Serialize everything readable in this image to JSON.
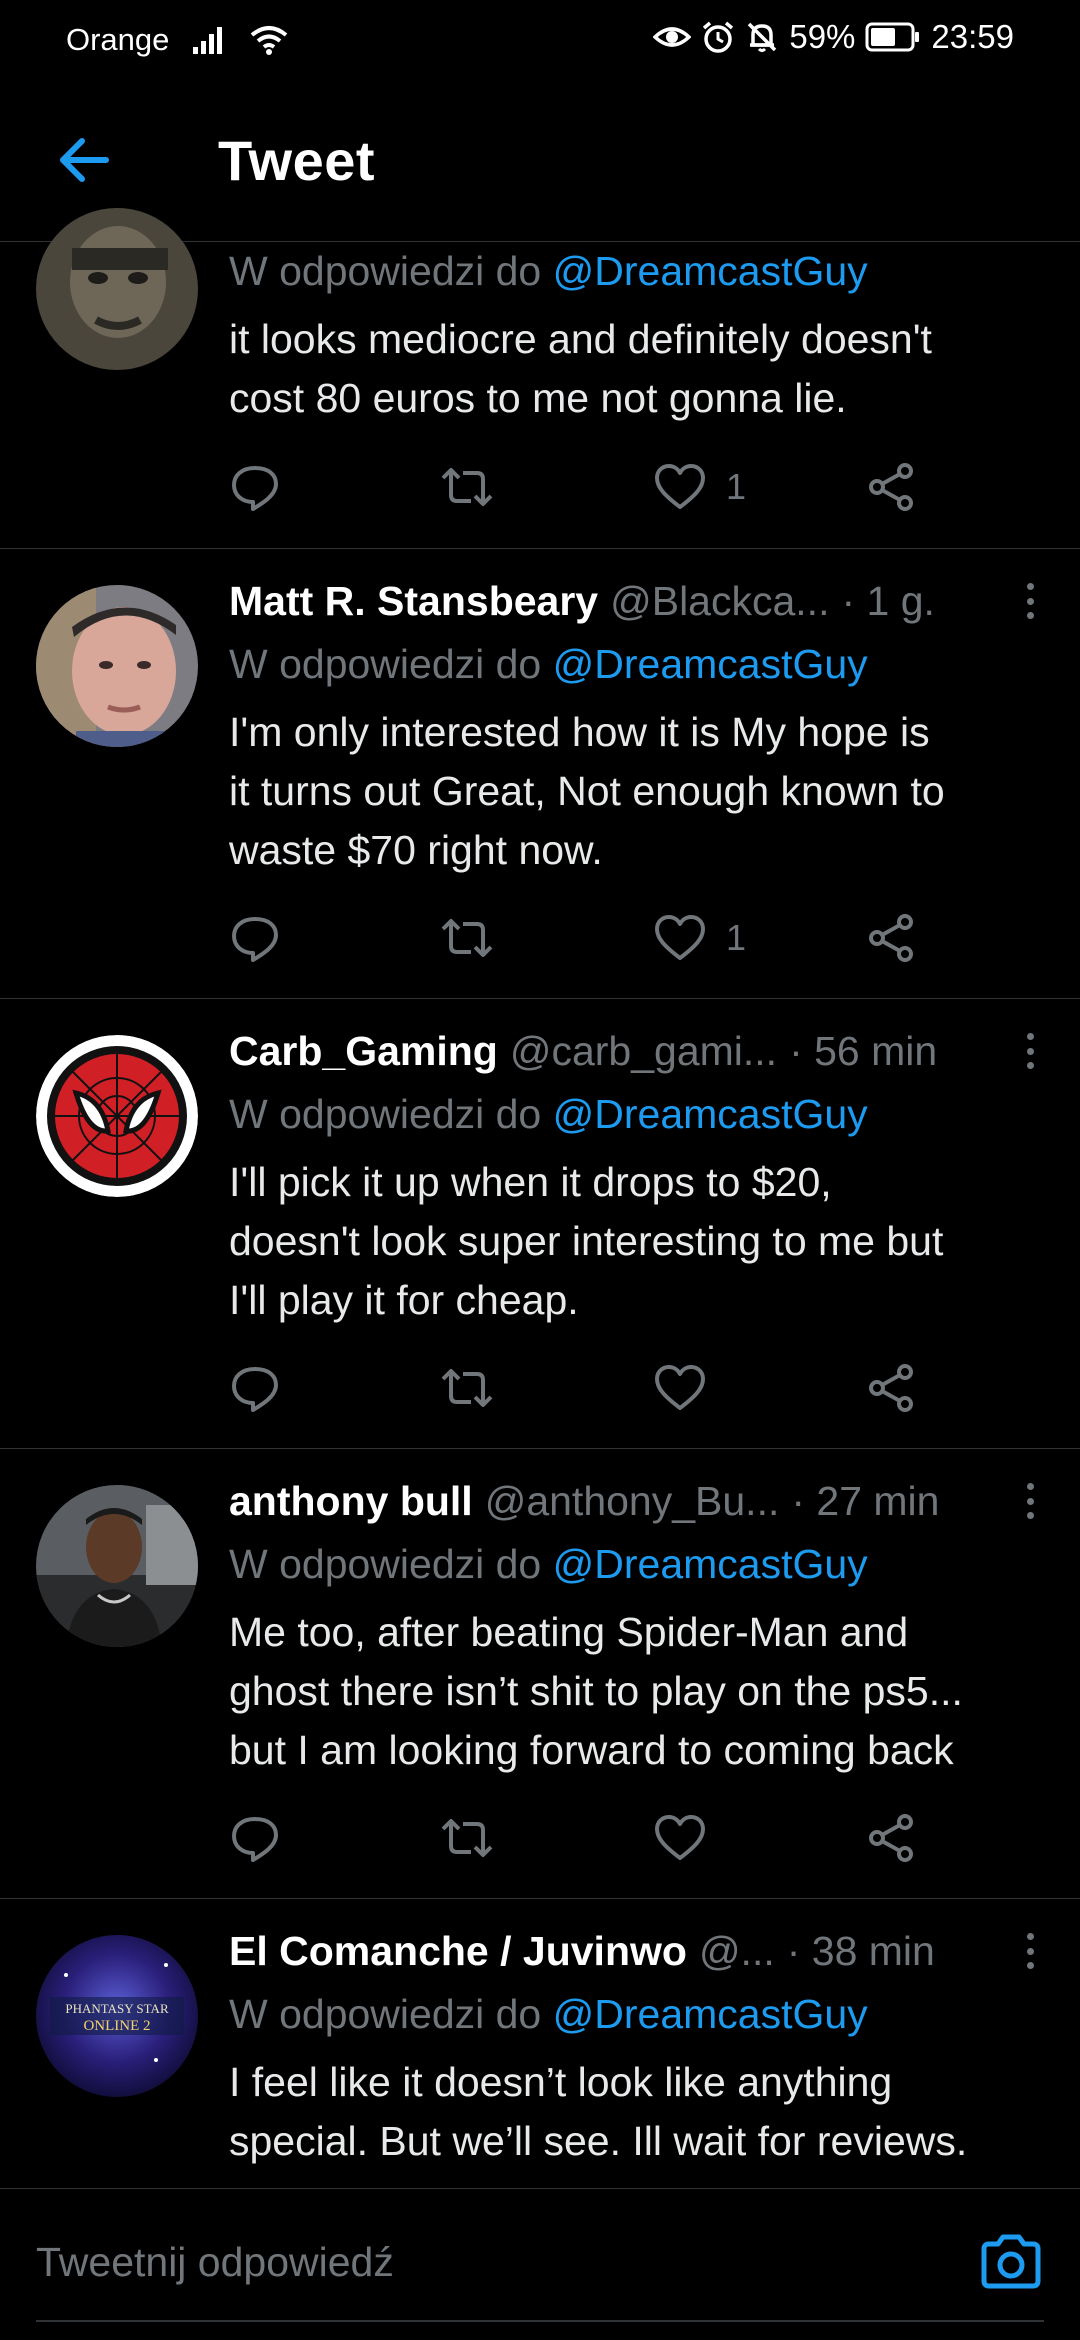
{
  "status_bar": {
    "carrier": "Orange",
    "battery": "59%",
    "time": "23:59"
  },
  "header": {
    "title": "Tweet"
  },
  "tweets": [
    {
      "name": "",
      "handle": "",
      "time": "",
      "reply_prefix": "W odpowiedzi do",
      "reply_mention": "@DreamcastGuy",
      "text": "it looks mediocre and definitely doesn't\ncost 80 euros to me not gonna lie.",
      "likes": "1"
    },
    {
      "name": "Matt R. Stansbeary",
      "handle": "@Blackca...",
      "time": "· 1 g.",
      "reply_prefix": "W odpowiedzi do",
      "reply_mention": "@DreamcastGuy",
      "text": "I'm only interested how it is  My hope is\nit turns out Great, Not enough known to\nwaste $70 right now.",
      "likes": "1"
    },
    {
      "name": "Carb_Gaming",
      "handle": "@carb_gami...",
      "time": "· 56 min",
      "reply_prefix": "W odpowiedzi do",
      "reply_mention": "@DreamcastGuy",
      "text": "I'll pick it up when it drops to $20,\ndoesn't look super interesting to me but\nI'll play it for cheap.",
      "likes": ""
    },
    {
      "name": "anthony bull",
      "handle": "@anthony_Bu...",
      "time": "· 27 min",
      "reply_prefix": "W odpowiedzi do",
      "reply_mention": "@DreamcastGuy",
      "text": "Me too, after beating Spider-Man and\nghost there isn’t shit to play on the ps5...\nbut I am looking forward to coming back",
      "likes": ""
    },
    {
      "name": "El Comanche / Juvinwo",
      "handle": "@...",
      "time": "· 38 min",
      "reply_prefix": "W odpowiedzi do",
      "reply_mention": "@DreamcastGuy",
      "text": "I feel like it doesn’t look like anything\nspecial. But we’ll see. Ill wait for reviews.",
      "likes": "",
      "avatar_text": [
        "PHANTASY STAR",
        "ONLINE 2"
      ]
    }
  ],
  "composer": {
    "placeholder": "Tweetnij odpowiedź"
  },
  "icons": {
    "back": "arrow-left-icon",
    "reply": "speech-bubble-icon",
    "retweet": "retweet-icon",
    "like": "heart-icon",
    "share": "share-icon",
    "more": "vertical-dots-icon",
    "camera": "camera-icon"
  },
  "colors": {
    "background": "#000000",
    "accent": "#1d9bf0",
    "secondary_text": "#71767b",
    "divider": "#2f3336"
  }
}
